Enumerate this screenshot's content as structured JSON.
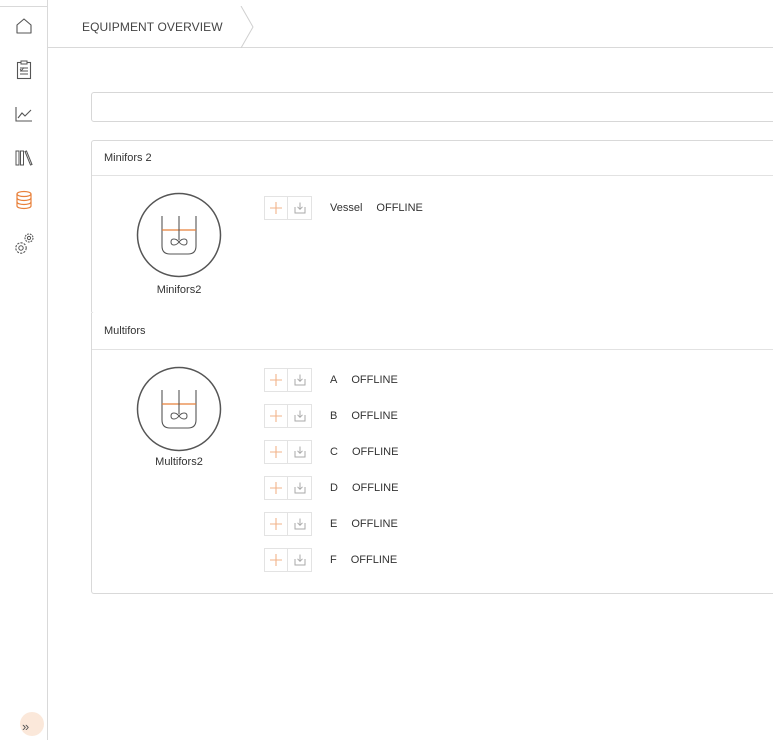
{
  "header": {
    "breadcrumb": "EQUIPMENT OVERVIEW"
  },
  "search": {
    "value": "",
    "placeholder": ""
  },
  "sidebar": {
    "items": [
      {
        "icon": "home-icon"
      },
      {
        "icon": "clipboard-icon"
      },
      {
        "icon": "line-chart-icon"
      },
      {
        "icon": "library-icon"
      },
      {
        "icon": "database-icon",
        "active": true
      },
      {
        "icon": "settings-gears-icon"
      }
    ],
    "expand_label": "»"
  },
  "colors": {
    "accent": "#e8803a",
    "border": "#d9d9d9",
    "icon_gray": "#555555"
  },
  "groups": [
    {
      "title": "Minifors 2",
      "reactor": "Minifors2",
      "units": [
        {
          "name": "Vessel",
          "status": "OFFLINE"
        }
      ]
    },
    {
      "title": "Multifors",
      "reactor": "Multifors2",
      "units": [
        {
          "name": "A",
          "status": "OFFLINE"
        },
        {
          "name": "B",
          "status": "OFFLINE"
        },
        {
          "name": "C",
          "status": "OFFLINE"
        },
        {
          "name": "D",
          "status": "OFFLINE"
        },
        {
          "name": "E",
          "status": "OFFLINE"
        },
        {
          "name": "F",
          "status": "OFFLINE"
        }
      ]
    }
  ]
}
